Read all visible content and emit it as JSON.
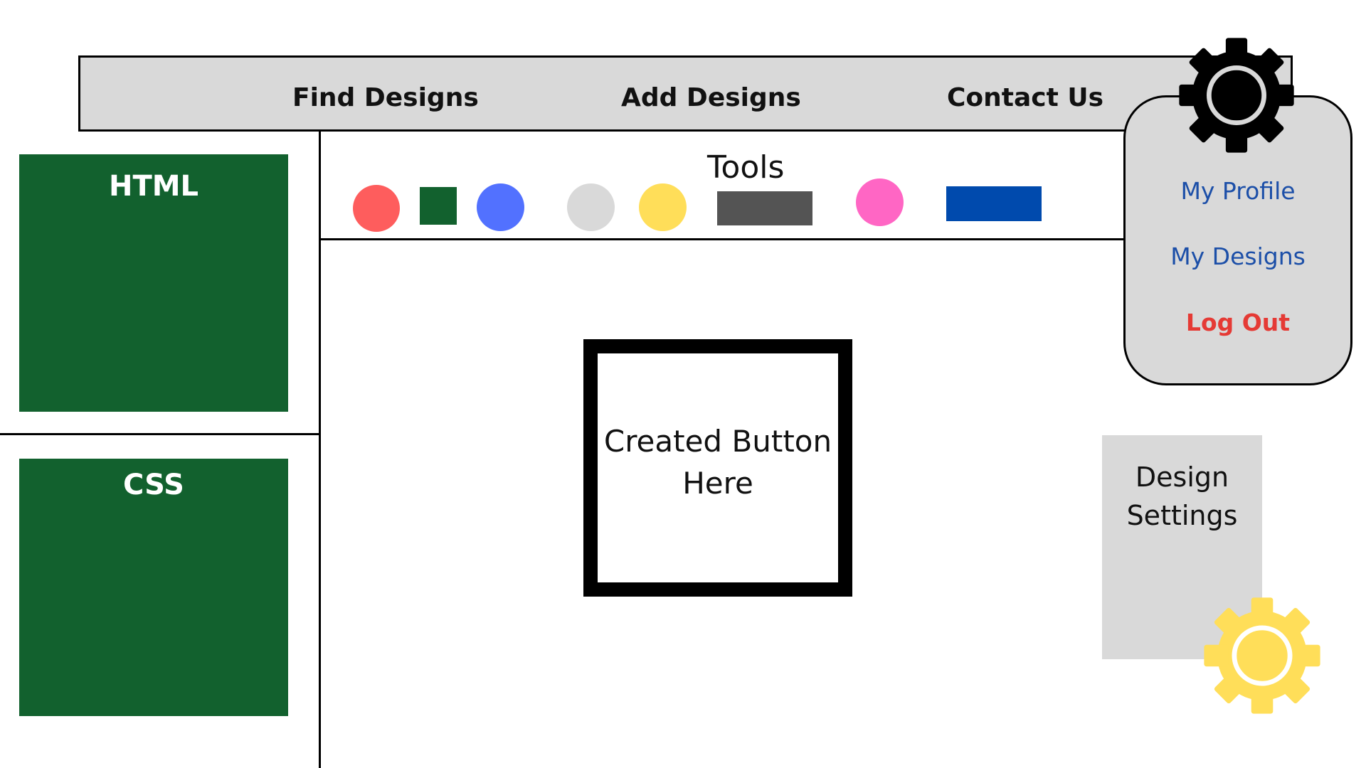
{
  "nav": {
    "find_designs": "Find Designs",
    "add_designs": "Add Designs",
    "contact_us": "Contact Us"
  },
  "profile_menu": {
    "my_profile": "My Profile",
    "my_designs": "My Designs",
    "log_out": "Log Out"
  },
  "panels": {
    "html_label": "HTML",
    "css_label": "CSS"
  },
  "tools": {
    "label": "Tools",
    "items": [
      {
        "shape": "circle",
        "color": "#fe5d5d"
      },
      {
        "shape": "square",
        "color": "#12612e"
      },
      {
        "shape": "circle",
        "color": "#5271ff"
      },
      {
        "shape": "circle",
        "color": "#d9d9d9"
      },
      {
        "shape": "circle",
        "color": "#ffde59"
      },
      {
        "shape": "rectangle",
        "color": "#545454"
      },
      {
        "shape": "circle",
        "color": "#ff66c4"
      },
      {
        "shape": "rectangle",
        "color": "#004aad"
      }
    ]
  },
  "preview": {
    "button_text": "Created Button\nHere"
  },
  "design_settings": {
    "label": "Design\nSettings"
  },
  "icons": {
    "settings_gear": "gear-icon",
    "design_settings_gear": "gear-icon"
  },
  "colors": {
    "navbar_bg": "#d9d9d9",
    "panel_green": "#12612e",
    "link_blue": "#1c4fa8",
    "logout_red": "#e53a35",
    "gear_yellow": "#ffde59"
  }
}
